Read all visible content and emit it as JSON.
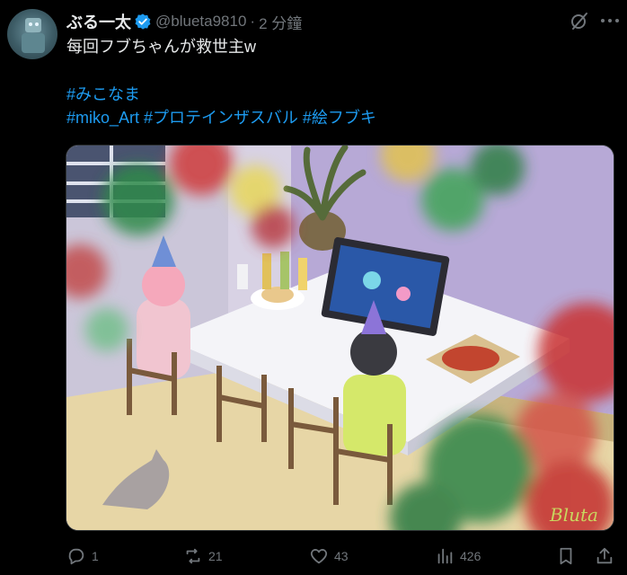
{
  "post": {
    "display_name": "ぶる一太",
    "handle": "@blueta9810",
    "separator": "·",
    "timestamp": "2 分鐘",
    "text": "每回フブちゃんが救世主w",
    "hashtags_line1": "#みこなま",
    "hashtags_line2": [
      "#miko_Art",
      "#プロテインザスバル",
      "#絵フブキ"
    ],
    "signature": "Bluta"
  },
  "actions": {
    "replies": "1",
    "reposts": "21",
    "likes": "43",
    "views": "426"
  },
  "icons": {
    "verified": "verified-badge-icon",
    "grok": "grok-icon",
    "more": "more-icon",
    "reply": "reply-icon",
    "repost": "repost-icon",
    "like": "heart-icon",
    "views": "views-icon",
    "bookmark": "bookmark-icon",
    "share": "share-icon"
  },
  "colors": {
    "link": "#1d9bf0",
    "muted": "#71767b",
    "text": "#e7e9ea",
    "background": "#000000"
  }
}
